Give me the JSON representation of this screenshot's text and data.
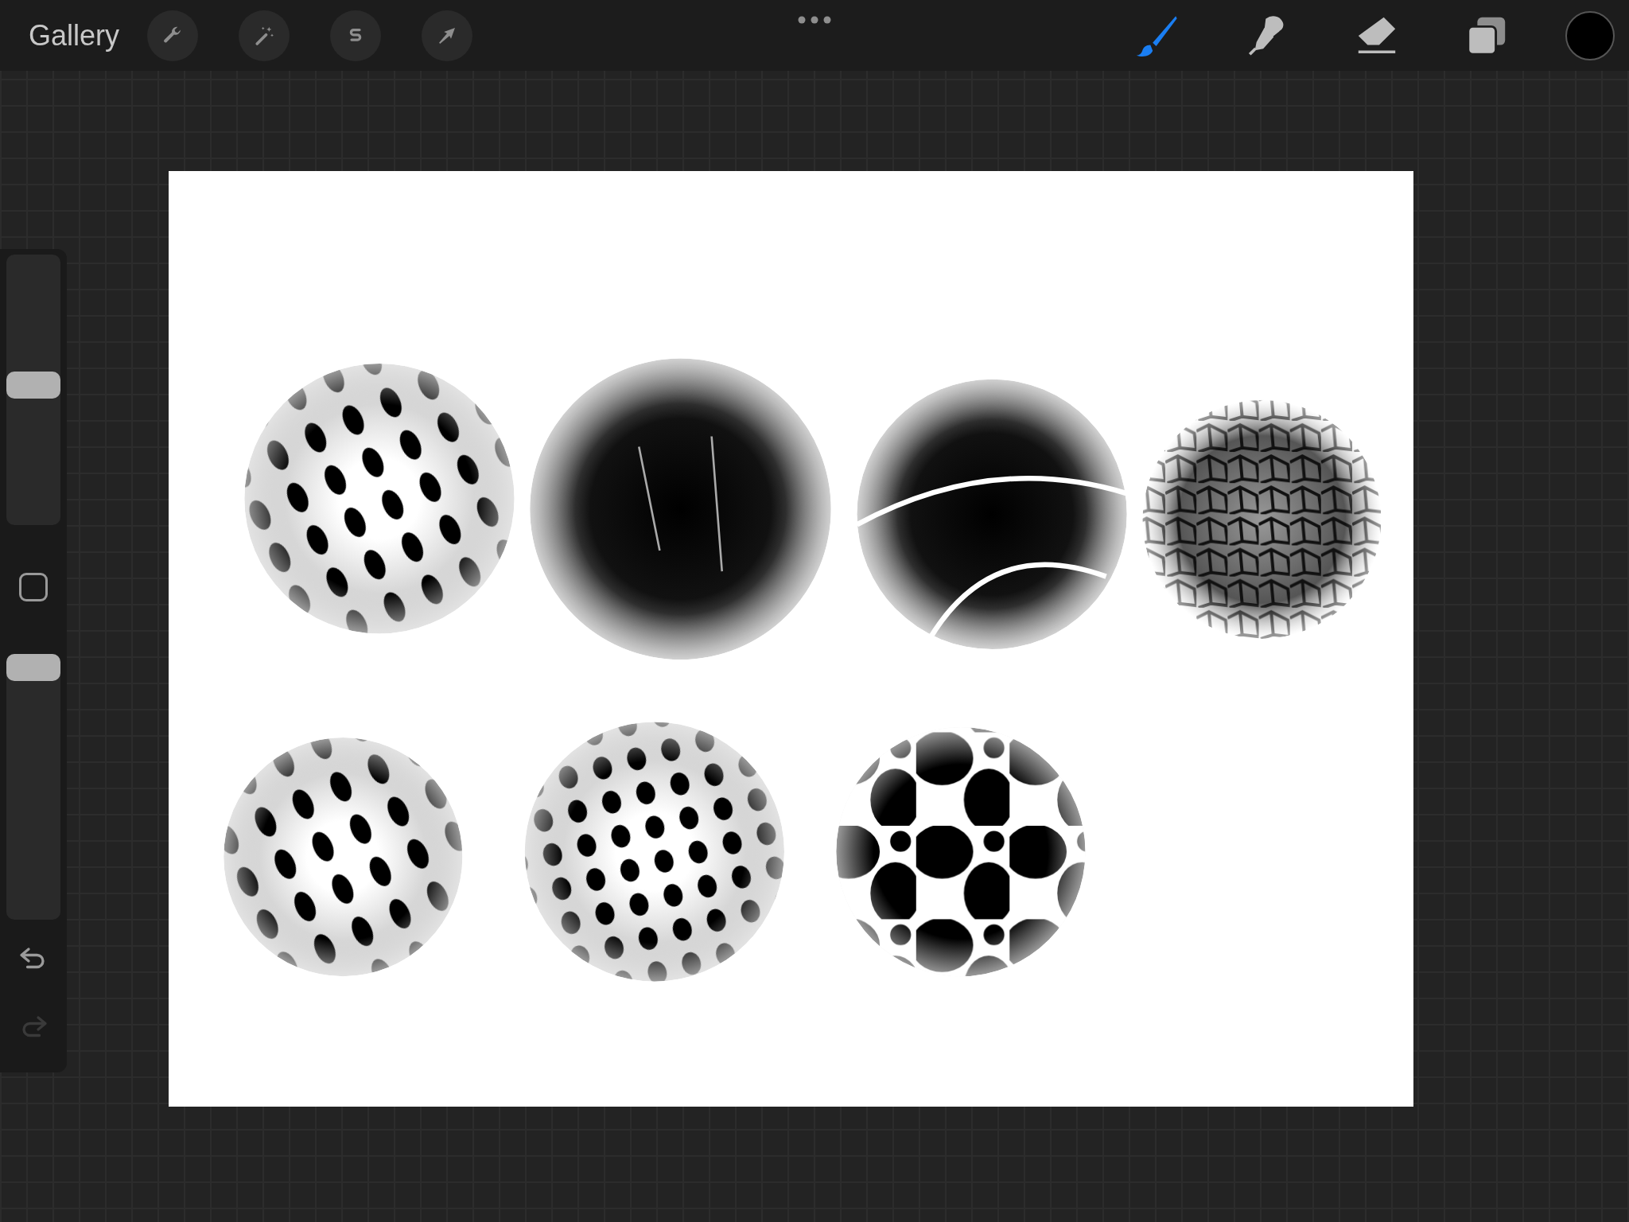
{
  "toolbar": {
    "gallery": "Gallery",
    "tools": [
      {
        "kind": "brush",
        "selected": true
      },
      {
        "kind": "smudge",
        "selected": false
      },
      {
        "kind": "eraser",
        "selected": false
      },
      {
        "kind": "layers",
        "selected": false
      }
    ],
    "color_swatch": {
      "color": "#000000"
    }
  },
  "sidebar": {
    "brush_size": {
      "level": 0.52
    },
    "opacity": {
      "level": 1.0
    },
    "undo": {
      "disabled": false
    },
    "redo": {
      "disabled": true
    }
  }
}
